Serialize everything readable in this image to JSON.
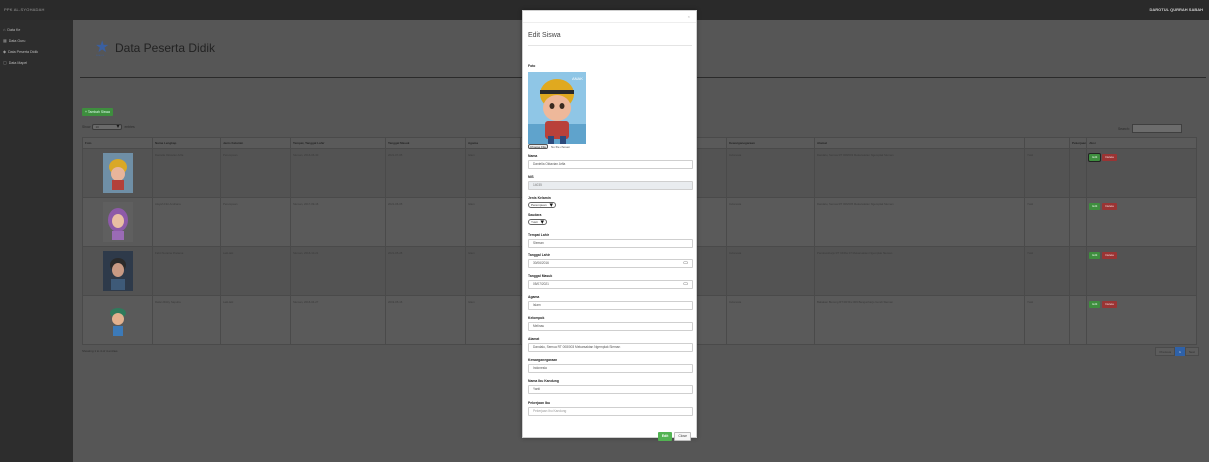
{
  "topbar": {
    "brand": "PPK AL-SYOHADAH",
    "user": "DAROTUL QURRAH SABAH"
  },
  "sidebar": {
    "items": [
      {
        "icon": "home-icon",
        "glyph": "⌂",
        "label": "Data Ke"
      },
      {
        "icon": "users-icon",
        "glyph": "▦",
        "label": "Data Guru"
      },
      {
        "icon": "student-icon",
        "glyph": "◆",
        "label": "Data Peserta Didik"
      },
      {
        "icon": "book-icon",
        "glyph": "▢",
        "label": "Data Mapel"
      }
    ]
  },
  "main": {
    "title": "Data Peserta Didik",
    "logo_caption": "SCHOOL",
    "add_button": "+ Tambah Siswa",
    "length_prefix": "Show",
    "length_value": "10",
    "length_suffix": "entries",
    "search_label": "Search:",
    "columns": [
      "Foto",
      "Nama Lengkap",
      "Jenis Kelamin",
      "Tempat, Tanggal Lahir",
      "Tanggal Masuk",
      "Agama",
      "",
      "",
      "",
      "Kelompok Ibu",
      "Kewarganegaraan",
      "Alamat",
      "",
      "Pekerjaan",
      "Aksi"
    ],
    "rows": [
      {
        "avatar": "helmet-kid",
        "name": "Daniella Oktavian Arfla",
        "gender": "Perempuan",
        "ttl": "Sleman, 2016-06-30",
        "masuk": "2021-07-05",
        "agama": "Islam",
        "c7": "",
        "c8": "",
        "c9": "",
        "kelompok": "",
        "warga": "Indonesia",
        "alamat": "Dandalu, Semua RT 008/003 Mekarsaktan Ngemplak Sleman",
        "c13": "Yusti",
        "pekerjaan": "",
        "edit": "Edit",
        "delete": "Delete",
        "focus": true
      },
      {
        "avatar": "hijab-girl",
        "name": "Aisyah Fitri Andriana",
        "gender": "Perempuan",
        "ttl": "Sleman, 2017-09-16",
        "masuk": "2021-06-05",
        "agama": "Islam",
        "c7": "",
        "c8": "",
        "c9": "",
        "kelompok": "",
        "warga": "Indonesia",
        "alamat": "Dandalu, Semua RT 006/005 Mekarsaktan Ngemplak Sleman",
        "c13": "Yusti",
        "pekerjaan": "",
        "edit": "Edit",
        "delete": "Delete",
        "focus": false
      },
      {
        "avatar": "boy-dark",
        "name": "Fahri Nuraina Pratama",
        "gender": "Laki-laki",
        "ttl": "Sleman, 2016-10-21",
        "masuk": "2021-05-28",
        "agama": "Islam",
        "c7": "",
        "c8": "",
        "c9": "",
        "kelompok": "",
        "warga": "Indonesia",
        "alamat": "Pandowoharjo RT 04/Rw 07 Mekarsaktan Ngemplak Sleman",
        "c13": "Yusti",
        "pekerjaan": "",
        "edit": "Edit",
        "delete": "Delete",
        "focus": false
      },
      {
        "avatar": "boy-cap",
        "name": "Rafan Rizky Saputra",
        "gender": "Laki-laki",
        "ttl": "Sleman, 2016-04-27",
        "masuk": "2019-05-16",
        "agama": "Islam",
        "c7": "",
        "c8": "",
        "c9": "",
        "kelompok": "",
        "warga": "Indonesia",
        "alamat": "Babakan Bunung RT 08/ Rw 009 Bangunharjo Gondi Sleman",
        "c13": "Yusti",
        "pekerjaan": "",
        "edit": "Edit",
        "delete": "Delete",
        "focus": false
      }
    ],
    "info": "Showing 1 to 4 of 4 entries",
    "pager": {
      "prev": "Previous",
      "page": "1",
      "next": "Next"
    }
  },
  "modal": {
    "close": "×",
    "title": "Edit Siswa",
    "foto_label": "Foto",
    "photo_tag": "ANAK",
    "file_button": "Choose File",
    "file_name": "No file chosen",
    "fields": {
      "nama": {
        "label": "Nama",
        "value": "Daniella Oktavian Arfla"
      },
      "nis": {
        "label": "NIS",
        "value": "14035"
      },
      "jk": {
        "label": "Jenis Kelamin",
        "value": "Perempuan"
      },
      "saudara": {
        "label": "Saudara",
        "value": "Yusti"
      },
      "tempat": {
        "label": "Tempat Lahir",
        "value": "Sleman"
      },
      "tgl_lahir": {
        "label": "Tanggal Lahir",
        "value": "30/06/2016"
      },
      "tgl_masuk": {
        "label": "Tanggal Masuk",
        "value": "05/07/2021"
      },
      "agama": {
        "label": "Agama",
        "value": "Islam"
      },
      "kelompok": {
        "label": "Kelompok",
        "value": "Melinau"
      },
      "alamat": {
        "label": "Alamat",
        "value": "Dandalu, Semua RT 008/003 Mekarsaktan Ngemplak Sleman"
      },
      "warga": {
        "label": "Kewarganegaraan",
        "value": "Indonesia"
      },
      "ibu": {
        "label": "Nama Ibu Kandung",
        "value": "Yanti"
      },
      "pekerjaan": {
        "label": "Pekerjaan Ibu",
        "placeholder": "Pekerjaan Ibu Kandung"
      }
    },
    "edit_button": "Edit",
    "close_button": "Close"
  }
}
